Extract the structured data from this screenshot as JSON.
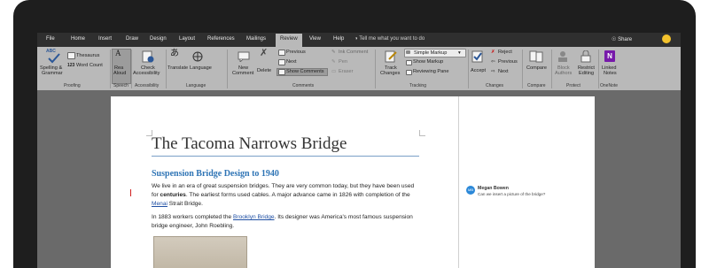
{
  "tabs": [
    "File",
    "Home",
    "Insert",
    "Draw",
    "Design",
    "Layout",
    "References",
    "Mailings",
    "Review",
    "View",
    "Help"
  ],
  "active_tab": "Review",
  "tell_me": "Tell me what you want to do",
  "share": "Share",
  "ribbon": {
    "proofing": {
      "abc": "ABC",
      "spelling": "Spelling &",
      "grammar": "Grammar",
      "thesaurus": "Thesaurus",
      "word_count": "Word Count",
      "label": "Proofing"
    },
    "speech": {
      "read_aloud_1": "Rea",
      "read_aloud_2": "Aloud",
      "label": "Speech"
    },
    "accessibility": {
      "check_1": "Check",
      "check_2": "Accessibility",
      "label": "Accessibility"
    },
    "language": {
      "translate": "Translate",
      "language": "Language",
      "label": "Language"
    },
    "comments": {
      "new_1": "New",
      "new_2": "Comment",
      "delete": "Delete",
      "previous": "Previous",
      "next": "Next",
      "show_comments": "Show Comments",
      "label": "Comments"
    },
    "ink": {
      "ink_comment": "Ink Comment",
      "pen": "Pen",
      "eraser": "Eraser"
    },
    "tracking": {
      "track_1": "Track",
      "track_2": "Changes",
      "simple_markup": "Simple Markup",
      "show_markup": "Show Markup",
      "reviewing_pane": "Reviewing Pane",
      "label": "Tracking"
    },
    "changes": {
      "accept": "Accept",
      "reject": "Reject",
      "previous": "Previous",
      "next": "Next",
      "label": "Changes"
    },
    "compare": {
      "compare": "Compare",
      "label": "Compare"
    },
    "protect": {
      "block_1": "Block",
      "block_2": "Authors",
      "restrict_1": "Restrict",
      "restrict_2": "Editing",
      "label": "Protect"
    },
    "onenote": {
      "linked_1": "Linked",
      "linked_2": "Notes",
      "label": "OneNote"
    }
  },
  "document": {
    "title": "The Tacoma Narrows Bridge",
    "heading": "Suspension Bridge Design to 1940",
    "p1_a": "We live in an era of great suspension bridges. They are very common today, but they have been used for ",
    "p1_bold": "centuries",
    "p1_b": ". The earliest forms used cables. A major advance came in 1826 with completion of the ",
    "p1_link": "Menai",
    "p1_c": " Strait Bridge.",
    "p2_a": "In 1883 workers completed the ",
    "p2_link": "Brooklyn Bridge",
    "p2_b": ". Its designer was America's most famous suspension bridge engineer, John Roebling."
  },
  "comment": {
    "initials": "MB",
    "author": "Megan Bowen",
    "text": "Can we insert a picture of the bridge?"
  },
  "colors": {
    "accent_blue": "#2e74b5",
    "link": "#1f4fa3",
    "avatar": "#2b88d8"
  }
}
